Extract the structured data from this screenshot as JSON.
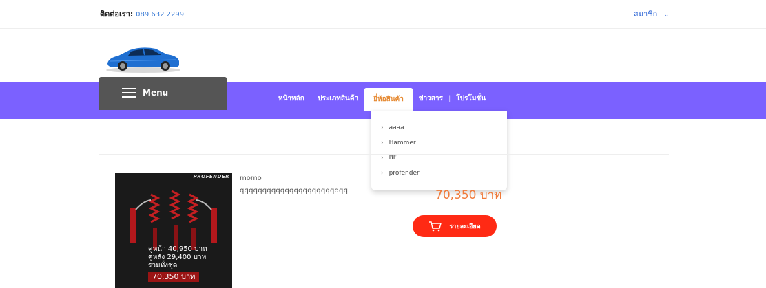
{
  "header": {
    "contact_label": "ติดต่อเรา:",
    "contact_phone": "089 632 2299",
    "member_label": "สมาชิก"
  },
  "menu": {
    "label": "Menu"
  },
  "nav": {
    "items": [
      {
        "label": "หน้าหลัก"
      },
      {
        "label": "ประเภทสินค้า"
      },
      {
        "label": "ยี่ห้อสินค้า"
      },
      {
        "label": "ข่าวสาร"
      },
      {
        "label": "โปรโมชั่น"
      }
    ],
    "active_index": 2
  },
  "dropdown": {
    "items": [
      {
        "label": "aaaa"
      },
      {
        "label": "Hammer"
      },
      {
        "label": "BF"
      },
      {
        "label": "profender"
      }
    ]
  },
  "product": {
    "name": "momo",
    "description": "qqqqqqqqqqqqqqqqqqqqqqqq",
    "price": "70,350 บาท",
    "detail_button": "รายละเอียด",
    "image": {
      "brand": "PROFENDER",
      "front_label": "คู่หน้า",
      "front_price": "40,950 บาท",
      "rear_label": "คู่หลัง",
      "rear_price": "29,400 บาท",
      "set_label": "รวมทั้งชุด",
      "set_price": "70,350 บาท"
    }
  },
  "colors": {
    "nav_band": "#7b61ff",
    "menu_box": "#555555",
    "accent_orange": "#f07a3a",
    "button_red": "#ff2a14"
  }
}
